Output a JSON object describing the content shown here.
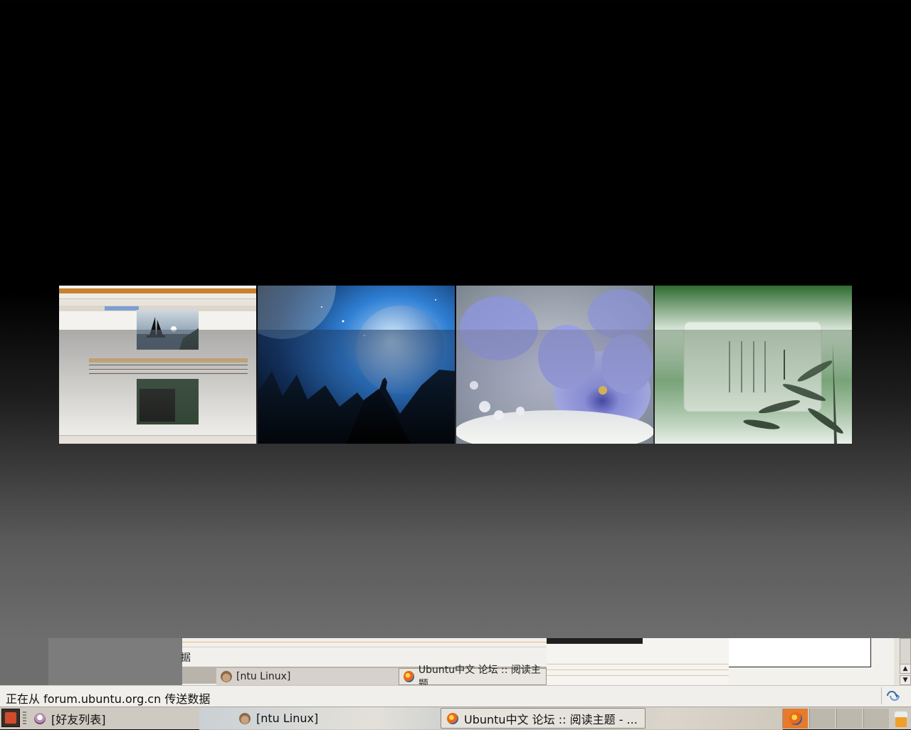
{
  "workspaces": {
    "items": [
      {
        "name": "workspace-1-browser"
      },
      {
        "name": "workspace-2-wolf-moon"
      },
      {
        "name": "workspace-3-pansy"
      },
      {
        "name": "workspace-4-bamboo"
      }
    ]
  },
  "fragments": {
    "partial_label": "据",
    "task_ntu": "[ntu Linux]",
    "task_ubuntu": "Ubuntu中文 论坛 :: 阅读主题"
  },
  "statusbar": {
    "text": "正在从 forum.ubuntu.org.cn 传送数据",
    "icon": "network-icon"
  },
  "taskbar": {
    "launcher_icon": "terminal-launcher-icon",
    "items": [
      {
        "label": "[好友列表]",
        "icon": "qq-icon",
        "active": false
      },
      {
        "label": "[ntu Linux]",
        "icon": "lock-icon",
        "active": false
      },
      {
        "label": "Ubuntu中文 论坛 :: 阅读主题 - ...",
        "icon": "firefox-icon",
        "active": true
      }
    ],
    "workspace_switcher": {
      "count": 4,
      "current": 1
    },
    "trash_icon": "trash-icon"
  },
  "colors": {
    "accent": "#e77a2b",
    "panel": "#cfcac1",
    "status_bg": "#f1efeb"
  }
}
